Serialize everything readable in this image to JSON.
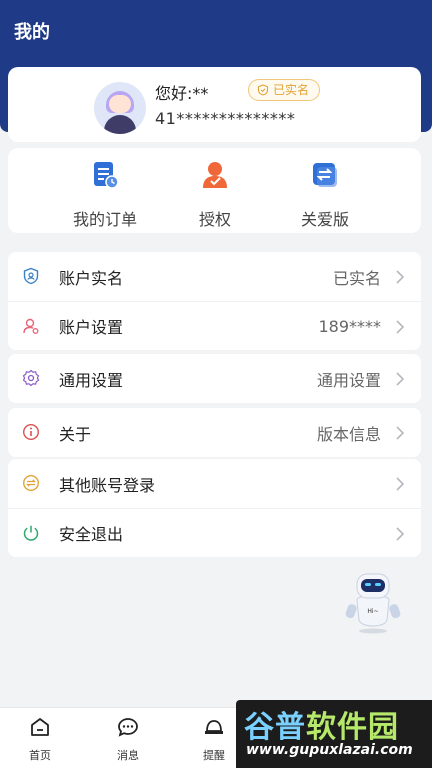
{
  "header": {
    "title": "我的"
  },
  "profile": {
    "greeting": "您好:**",
    "verified_label": "已实名",
    "account_id": "41**************"
  },
  "quick_actions": [
    {
      "label": "我的订单",
      "icon": "order-list-icon"
    },
    {
      "label": "授权",
      "icon": "authorization-person-icon"
    },
    {
      "label": "关爱版",
      "icon": "switch-mode-icon"
    }
  ],
  "menu": {
    "group1": [
      {
        "label": "账户实名",
        "value": "已实名",
        "icon": "shield-id-icon"
      },
      {
        "label": "账户设置",
        "value": "189****",
        "icon": "user-settings-icon"
      }
    ],
    "group2": [
      {
        "label": "通用设置",
        "value": "通用设置",
        "icon": "gear-icon"
      }
    ],
    "group3": [
      {
        "label": "关于",
        "value": "版本信息",
        "icon": "info-icon"
      }
    ],
    "group4": [
      {
        "label": "其他账号登录",
        "value": "",
        "icon": "switch-account-icon"
      },
      {
        "label": "安全退出",
        "value": "",
        "icon": "power-icon"
      }
    ]
  },
  "assistant": {
    "badge": "Hi~"
  },
  "tabbar": [
    {
      "label": "首页",
      "icon": "home-icon"
    },
    {
      "label": "消息",
      "icon": "message-icon"
    },
    {
      "label": "提醒",
      "icon": "bell-icon"
    }
  ],
  "watermark": {
    "logo_part1": "谷普",
    "logo_part2": "软件园",
    "url": "www.gupuxlazai.com"
  },
  "colors": {
    "header": "#1f3a86",
    "accent_gold": "#e2a336",
    "quick_blue": "#2f6fd6",
    "quick_orange": "#f0683a"
  }
}
